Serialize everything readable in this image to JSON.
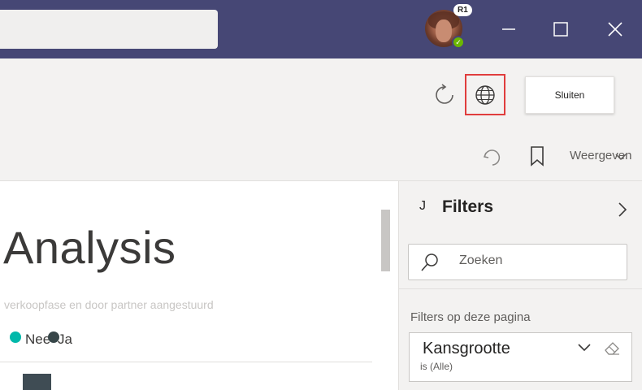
{
  "titlebar": {
    "badge": "R1",
    "presence_status": "available",
    "presence_color": "#6bb700",
    "background_color": "#464775",
    "icons": [
      "minimize-icon",
      "maximize-icon",
      "close-icon"
    ]
  },
  "toolbar": {
    "refresh_icon": "refresh-icon",
    "language_icon": "globe-icon",
    "close_label": "Sluiten",
    "view_label": "Weergeven",
    "highlight_color": "#e03d3d"
  },
  "report": {
    "title": "Analysis",
    "subtitle": "verkoopfase en door partner aangestuurd",
    "legend": [
      {
        "label": "Nee",
        "color": "#01b8aa"
      },
      {
        "label": "Ja",
        "color": "#374649"
      }
    ]
  },
  "filters": {
    "glyph": "J",
    "title": "Filters",
    "search_placeholder": "Zoeken",
    "section_label": "Filters op deze pagina",
    "cards": [
      {
        "title": "Kansgrootte",
        "subtitle": "is (Alle)"
      }
    ]
  }
}
